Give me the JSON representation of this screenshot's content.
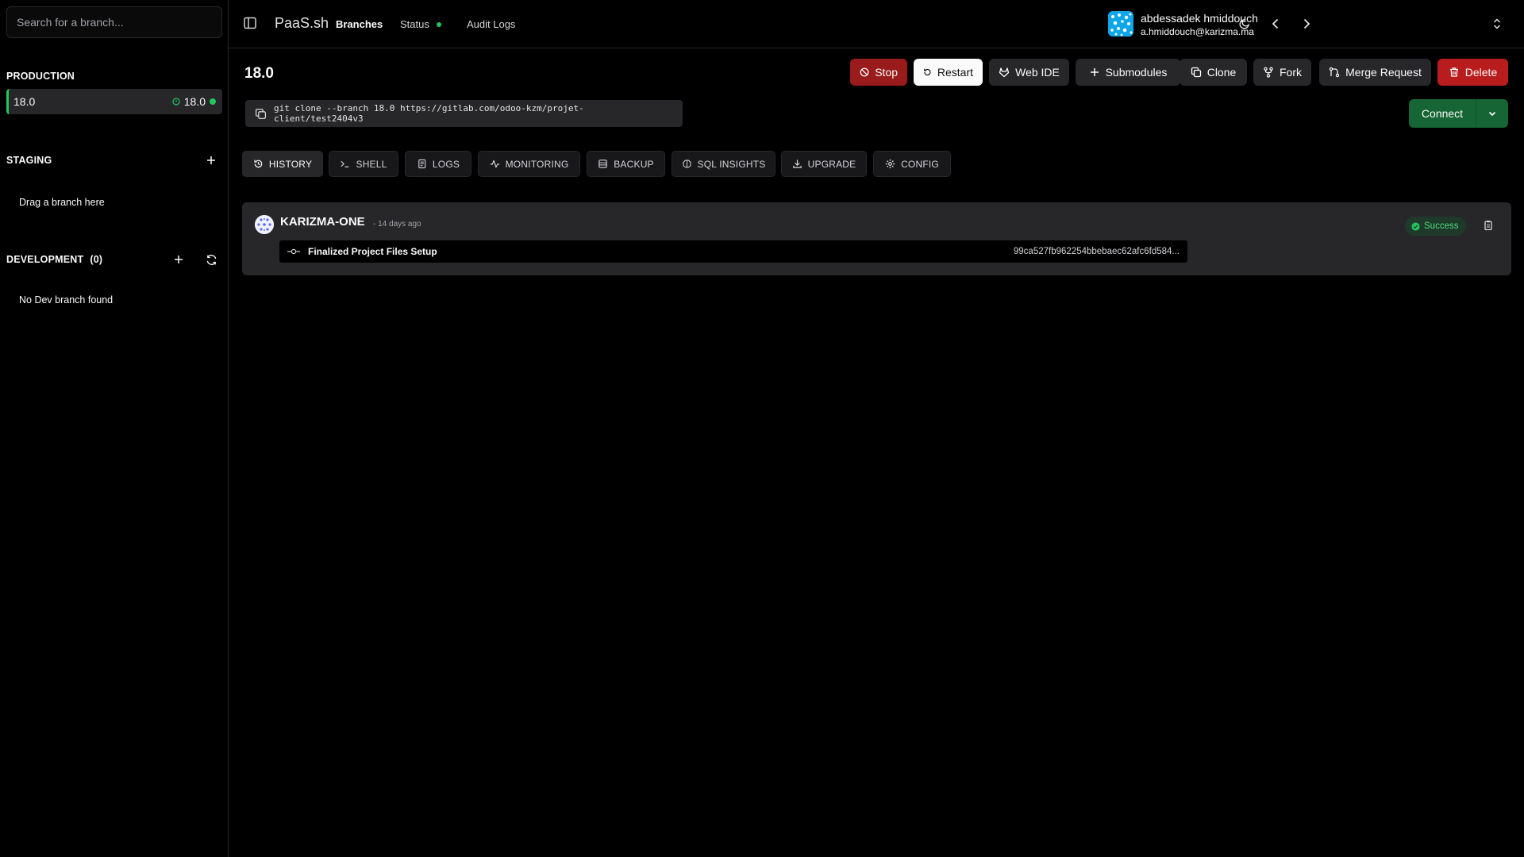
{
  "sidebar": {
    "search_placeholder": "Search for a branch...",
    "production": {
      "title": "PRODUCTION",
      "branch": {
        "name": "18.0",
        "version": "18.0",
        "status_color": "#22c55e"
      }
    },
    "staging": {
      "title": "STAGING",
      "empty_text": "Drag a branch here"
    },
    "development": {
      "title": "DEVELOPMENT",
      "count": "(0)",
      "empty_text": "No Dev branch found"
    }
  },
  "topbar": {
    "brand": "PaaS.sh",
    "nav": {
      "branches": "Branches",
      "status": "Status",
      "audit_logs": "Audit Logs"
    },
    "status_dot_color": "#22c55e",
    "icons": [
      "sidebar-toggle-icon",
      "moon-icon",
      "chevron-left-icon",
      "chevron-right-icon",
      "chevrons-up-down-icon"
    ],
    "user": {
      "name": "abdessadek hmiddouch",
      "email": "a.hmiddouch@karizma.ma"
    }
  },
  "branch": {
    "title": "18.0",
    "actions": {
      "stop": "Stop",
      "restart": "Restart",
      "web_ide": "Web IDE",
      "submodules": "Submodules",
      "clone": "Clone",
      "fork": "Fork",
      "merge_request": "Merge Request",
      "delete": "Delete"
    },
    "clone_command": "git clone --branch 18.0 https://gitlab.com/odoo-kzm/projet-client/test2404v3",
    "connect": "Connect"
  },
  "tabs": {
    "history": "HISTORY",
    "shell": "SHELL",
    "logs": "LOGS",
    "monitoring": "MONITORING",
    "backup": "BACKUP",
    "sql_insights": "SQL INSIGHTS",
    "upgrade": "UPGRADE",
    "config": "CONFIG"
  },
  "history": {
    "entry": {
      "author": "KARIZMA-ONE",
      "time": "- 14 days ago",
      "status": "Success",
      "commit_message": "Finalized Project Files Setup",
      "commit_hash": "99ca527fb962254bbebaec62afc6fd584..."
    }
  },
  "colors": {
    "accent_green": "#22c55e",
    "connect_green": "#166534",
    "stop_red": "#991b1b",
    "delete_red": "#b91c1c"
  }
}
